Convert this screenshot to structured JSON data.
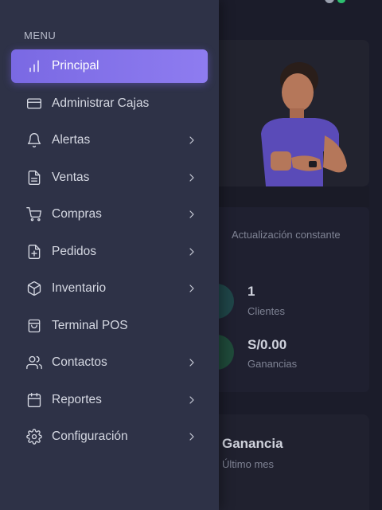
{
  "background": {
    "hero_caption": "Actualización constante",
    "stats": [
      {
        "value": "1",
        "label": "Clientes"
      },
      {
        "value": "S/0.00",
        "label": "Ganancias"
      }
    ],
    "gain_card": {
      "title": "Ganancia",
      "subtitle": "Último mes"
    }
  },
  "sidebar": {
    "heading": "MENU",
    "items": [
      {
        "label": "Principal",
        "icon": "bar-chart-icon",
        "active": true,
        "submenu": false
      },
      {
        "label": "Administrar Cajas",
        "icon": "credit-card-icon",
        "active": false,
        "submenu": false
      },
      {
        "label": "Alertas",
        "icon": "bell-icon",
        "active": false,
        "submenu": true
      },
      {
        "label": "Ventas",
        "icon": "file-text-icon",
        "active": false,
        "submenu": true
      },
      {
        "label": "Compras",
        "icon": "shopping-cart-icon",
        "active": false,
        "submenu": true
      },
      {
        "label": "Pedidos",
        "icon": "file-plus-icon",
        "active": false,
        "submenu": true
      },
      {
        "label": "Inventario",
        "icon": "box-icon",
        "active": false,
        "submenu": true
      },
      {
        "label": "Terminal POS",
        "icon": "shopping-bag-icon",
        "active": false,
        "submenu": false
      },
      {
        "label": "Contactos",
        "icon": "users-icon",
        "active": false,
        "submenu": true
      },
      {
        "label": "Reportes",
        "icon": "calendar-icon",
        "active": false,
        "submenu": true
      },
      {
        "label": "Configuración",
        "icon": "settings-icon",
        "active": false,
        "submenu": true
      }
    ]
  },
  "colors": {
    "sidebar_bg": "#2e3247",
    "accent": "#8474ea",
    "page_bg": "#1b1c2a"
  }
}
